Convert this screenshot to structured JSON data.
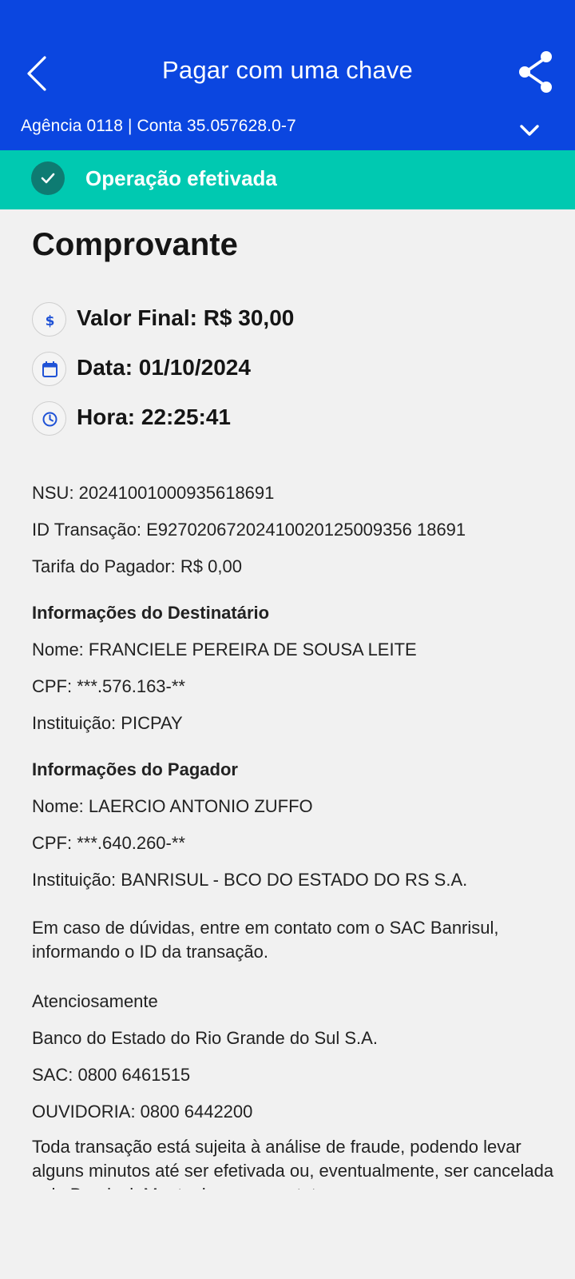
{
  "header": {
    "title": "Pagar com uma chave",
    "account": "Agência 0118 | Conta 35.057628.0-7",
    "back_icon": "chevron-left-icon",
    "share_icon": "share-icon",
    "expand_icon": "chevron-down-icon"
  },
  "status": {
    "text": "Operação efetivada",
    "color": "#00c9b1"
  },
  "receipt": {
    "heading": "Comprovante",
    "summary": {
      "value": "Valor Final: R$ 30,00",
      "date": "Data: 01/10/2024",
      "time": "Hora: 22:25:41"
    },
    "nsu": "NSU: 20241001000935618691",
    "transaction_id": "ID Transação: E92702067202410020125009356 18691",
    "payer_fee": "Tarifa do Pagador: R$ 0,00",
    "recipient": {
      "title": "Informações do Destinatário",
      "name": "Nome: FRANCIELE PEREIRA DE SOUSA LEITE",
      "cpf": "CPF: ***.576.163-**",
      "institution": "Instituição: PICPAY"
    },
    "payer": {
      "title": "Informações do Pagador",
      "name": "Nome: LAERCIO ANTONIO ZUFFO",
      "cpf": "CPF: ***.640.260-**",
      "institution": "Instituição: BANRISUL - BCO DO ESTADO DO RS S.A."
    },
    "doubts": "Em caso de dúvidas, entre em contato com o SAC Banrisul, informando o ID da transação.",
    "regards": "Atenciosamente",
    "bank": "Banco do Estado do Rio Grande do Sul S.A.",
    "sac": "SAC: 0800 6461515",
    "ombudsman": "OUVIDORIA: 0800 6442200",
    "fraud_notice": "Toda transação está sujeita à análise de fraude, podendo levar alguns minutos até ser efetivada ou, eventualmente, ser cancelada pelo Banrisul. Mantenha seus contatos"
  },
  "colors": {
    "brand_blue": "#0b46e0",
    "success_teal": "#00c9b1",
    "icon_blue": "#1f52d6"
  }
}
